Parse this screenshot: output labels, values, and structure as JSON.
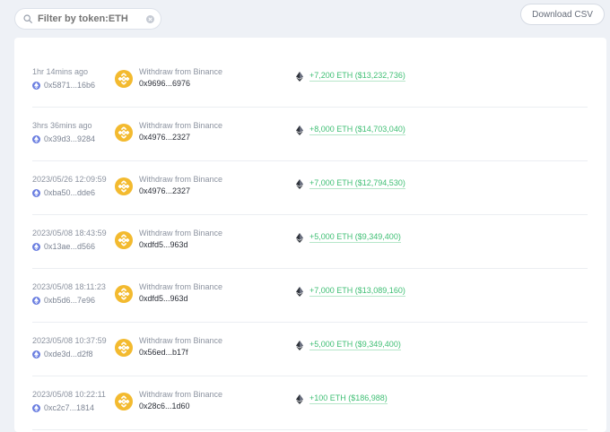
{
  "filter": {
    "placeholder": "Filter by token:ETH",
    "value": ""
  },
  "toolbar": {
    "download_label": "Download CSV"
  },
  "colors": {
    "eth_blue": "#6a7ee0",
    "binance_yellow": "#f3ba2f",
    "amount_green": "#3fbf74"
  },
  "transfers": [
    {
      "time": "1hr 14mins ago",
      "to_address": "0x5871...16b6",
      "label": "Withdraw from Binance",
      "from_address": "0x9696...6976",
      "amount": "+7,200 ETH ($13,232,736)"
    },
    {
      "time": "3hrs 36mins ago",
      "to_address": "0x39d3...9284",
      "label": "Withdraw from Binance",
      "from_address": "0x4976...2327",
      "amount": "+8,000 ETH ($14,703,040)"
    },
    {
      "time": "2023/05/26 12:09:59",
      "to_address": "0xba50...dde6",
      "label": "Withdraw from Binance",
      "from_address": "0x4976...2327",
      "amount": "+7,000 ETH ($12,794,530)"
    },
    {
      "time": "2023/05/08 18:43:59",
      "to_address": "0x13ae...d566",
      "label": "Withdraw from Binance",
      "from_address": "0xdfd5...963d",
      "amount": "+5,000 ETH ($9,349,400)"
    },
    {
      "time": "2023/05/08 18:11:23",
      "to_address": "0xb5d6...7e96",
      "label": "Withdraw from Binance",
      "from_address": "0xdfd5...963d",
      "amount": "+7,000 ETH ($13,089,160)"
    },
    {
      "time": "2023/05/08 10:37:59",
      "to_address": "0xde3d...d2f8",
      "label": "Withdraw from Binance",
      "from_address": "0x56ed...b17f",
      "amount": "+5,000 ETH ($9,349,400)"
    },
    {
      "time": "2023/05/08 10:22:11",
      "to_address": "0xc2c7...1814",
      "label": "Withdraw from Binance",
      "from_address": "0x28c6...1d60",
      "amount": "+100 ETH ($186,988)"
    }
  ]
}
